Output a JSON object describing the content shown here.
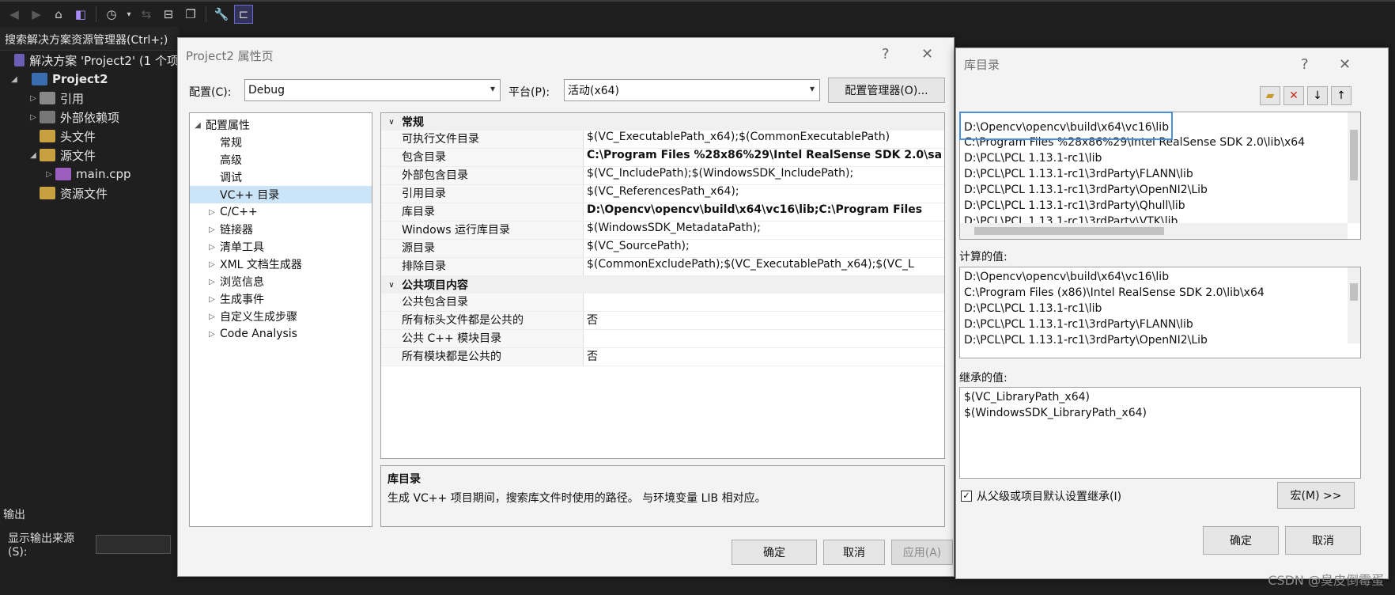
{
  "toolbar": {
    "icons": [
      "back-icon",
      "forward-icon",
      "home-icon",
      "vs-switch-icon",
      "history-icon",
      "dropdown-icon",
      "sync-icon",
      "collapse-all-icon",
      "show-all-icon",
      "wrench-icon",
      "preview-icon"
    ]
  },
  "explorer": {
    "search_label": "搜索解决方案资源管理器(Ctrl+;)",
    "solution_label": "解决方案 'Project2' (1 个项",
    "project": "Project2",
    "items": [
      {
        "label": "引用",
        "indent": 1,
        "expander": "▷"
      },
      {
        "label": "外部依赖项",
        "indent": 1,
        "expander": "▷"
      },
      {
        "label": "头文件",
        "indent": 1,
        "expander": ""
      },
      {
        "label": "源文件",
        "indent": 1,
        "expander": "◢"
      },
      {
        "label": "main.cpp",
        "indent": 2,
        "expander": "▷"
      },
      {
        "label": "资源文件",
        "indent": 1,
        "expander": ""
      }
    ]
  },
  "output": {
    "title": "输出",
    "source_label": "显示输出来源(S):"
  },
  "props_dialog": {
    "title": "Project2 属性页",
    "help": "?",
    "close": "✕",
    "config_label": "配置(C):",
    "config_value": "Debug",
    "platform_label": "平台(P):",
    "platform_value": "活动(x64)",
    "config_manager_label": "配置管理器(O)...",
    "nav_root": "配置属性",
    "nav_items": [
      {
        "label": "常规",
        "expander": ""
      },
      {
        "label": "高级",
        "expander": ""
      },
      {
        "label": "调试",
        "expander": ""
      },
      {
        "label": "VC++ 目录",
        "expander": "",
        "selected": true
      },
      {
        "label": "C/C++",
        "expander": "▷"
      },
      {
        "label": "链接器",
        "expander": "▷"
      },
      {
        "label": "清单工具",
        "expander": "▷"
      },
      {
        "label": "XML 文档生成器",
        "expander": "▷"
      },
      {
        "label": "浏览信息",
        "expander": "▷"
      },
      {
        "label": "生成事件",
        "expander": "▷"
      },
      {
        "label": "自定义生成步骤",
        "expander": "▷"
      },
      {
        "label": "Code Analysis",
        "expander": "▷"
      }
    ],
    "cat_general": "常规",
    "general_rows": [
      {
        "k": "可执行文件目录",
        "v": "$(VC_ExecutablePath_x64);$(CommonExecutablePath)",
        "bold": false
      },
      {
        "k": "包含目录",
        "v": "C:\\Program Files %28x86%29\\Intel RealSense SDK 2.0\\sa",
        "bold": true
      },
      {
        "k": "外部包含目录",
        "v": "$(VC_IncludePath);$(WindowsSDK_IncludePath);",
        "bold": false
      },
      {
        "k": "引用目录",
        "v": "$(VC_ReferencesPath_x64);",
        "bold": false
      },
      {
        "k": "库目录",
        "v": "D:\\Opencv\\opencv\\build\\x64\\vc16\\lib;C:\\Program Files",
        "bold": true
      },
      {
        "k": "Windows 运行库目录",
        "v": "$(WindowsSDK_MetadataPath);",
        "bold": false
      },
      {
        "k": "源目录",
        "v": "$(VC_SourcePath);",
        "bold": false
      },
      {
        "k": "排除目录",
        "v": "$(CommonExcludePath);$(VC_ExecutablePath_x64);$(VC_L",
        "bold": false
      }
    ],
    "cat_public": "公共项目内容",
    "public_rows": [
      {
        "k": "公共包含目录",
        "v": "",
        "bold": false
      },
      {
        "k": "所有标头文件都是公共的",
        "v": "否",
        "bold": false
      },
      {
        "k": "公共 C++ 模块目录",
        "v": "",
        "bold": false
      },
      {
        "k": "所有模块都是公共的",
        "v": "否",
        "bold": false
      }
    ],
    "desc_title": "库目录",
    "desc_text": "生成 VC++ 项目期间，搜索库文件时使用的路径。 与环境变量 LIB 相对应。",
    "ok_label": "确定",
    "cancel_label": "取消",
    "apply_label": "应用(A)"
  },
  "lib_dialog": {
    "title": "库目录",
    "help": "?",
    "close": "✕",
    "entries": [
      "D:\\Opencv\\opencv\\build\\x64\\vc16\\lib",
      "C:\\Program Files %28x86%29\\Intel RealSense SDK 2.0\\lib\\x64",
      "D:\\PCL\\PCL 1.13.1-rc1\\lib",
      "D:\\PCL\\PCL 1.13.1-rc1\\3rdParty\\FLANN\\lib",
      "D:\\PCL\\PCL 1.13.1-rc1\\3rdParty\\OpenNI2\\Lib",
      "D:\\PCL\\PCL 1.13.1-rc1\\3rdParty\\Qhull\\lib",
      "D:\\PCL\\PCL 1.13.1-rc1\\3rdParty\\VTK\\lib"
    ],
    "computed_label": "计算的值:",
    "computed": [
      "D:\\Opencv\\opencv\\build\\x64\\vc16\\lib",
      "C:\\Program Files (x86)\\Intel RealSense SDK 2.0\\lib\\x64",
      "D:\\PCL\\PCL 1.13.1-rc1\\lib",
      "D:\\PCL\\PCL 1.13.1-rc1\\3rdParty\\FLANN\\lib",
      "D:\\PCL\\PCL 1.13.1-rc1\\3rdParty\\OpenNI2\\Lib"
    ],
    "inherited_label": "继承的值:",
    "inherited": [
      "$(VC_LibraryPath_x64)",
      "$(WindowsSDK_LibraryPath_x64)"
    ],
    "inherit_checkbox_label": "从父级或项目默认设置继承(I)",
    "inherit_checked": true,
    "macro_label": "宏(M) >>",
    "ok_label": "确定",
    "cancel_label": "取消"
  },
  "watermark": "CSDN @臭皮倒霉蛋",
  "colors": {
    "ide_bg": "#1f1f1f",
    "dialog_bg": "#f3f3f3",
    "selection": "#cce4f7",
    "highlight_border": "#4a90d9"
  }
}
